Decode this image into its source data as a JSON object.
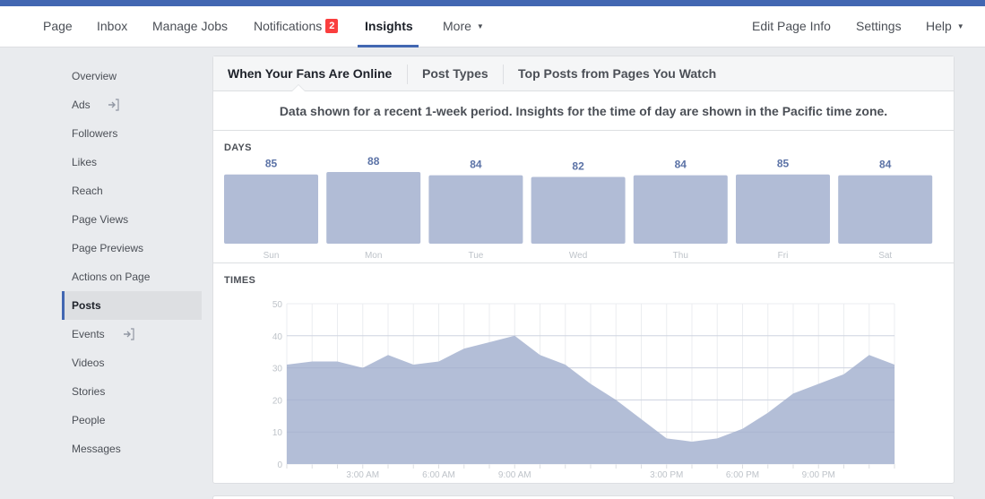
{
  "nav": {
    "left": [
      {
        "label": "Page"
      },
      {
        "label": "Inbox"
      },
      {
        "label": "Manage Jobs"
      },
      {
        "label": "Notifications",
        "badge": "2"
      },
      {
        "label": "Insights",
        "active": true
      },
      {
        "label": "More",
        "dropdown": true
      }
    ],
    "right": [
      {
        "label": "Edit Page Info"
      },
      {
        "label": "Settings"
      },
      {
        "label": "Help",
        "dropdown": true
      }
    ],
    "accent_color": "#4267b2",
    "badge_color": "#fa3e3e"
  },
  "sidebar": {
    "items": [
      {
        "label": "Overview"
      },
      {
        "label": "Ads",
        "icon": "external-link-icon"
      },
      {
        "label": "Followers"
      },
      {
        "label": "Likes"
      },
      {
        "label": "Reach"
      },
      {
        "label": "Page Views"
      },
      {
        "label": "Page Previews"
      },
      {
        "label": "Actions on Page"
      },
      {
        "label": "Posts",
        "active": true
      },
      {
        "label": "Events",
        "icon": "external-link-icon"
      },
      {
        "label": "Videos"
      },
      {
        "label": "Stories"
      },
      {
        "label": "People"
      },
      {
        "label": "Messages"
      }
    ]
  },
  "main": {
    "tabs": [
      {
        "label": "When Your Fans Are Online",
        "active": true
      },
      {
        "label": "Post Types"
      },
      {
        "label": "Top Posts from Pages You Watch"
      }
    ],
    "info_text": "Data shown for a recent 1-week period. Insights for the time of day are shown in the Pacific time zone.",
    "days_title": "DAYS",
    "times_title": "TIMES"
  },
  "chart_data": [
    {
      "type": "bar",
      "title": "DAYS",
      "categories": [
        "Sun",
        "Mon",
        "Tue",
        "Wed",
        "Thu",
        "Fri",
        "Sat"
      ],
      "values": [
        85,
        88,
        84,
        82,
        84,
        85,
        84
      ],
      "data_labels": true,
      "color": "#b1bcd6",
      "label_color": "#5b72a6"
    },
    {
      "type": "area",
      "title": "TIMES",
      "x": [
        0,
        1,
        2,
        3,
        4,
        5,
        6,
        7,
        8,
        9,
        10,
        11,
        12,
        13,
        14,
        15,
        16,
        17,
        18,
        19,
        20,
        21,
        22,
        23,
        24
      ],
      "values": [
        31,
        32,
        32,
        30,
        34,
        31,
        32,
        36,
        38,
        40,
        34,
        31,
        25,
        20,
        14,
        8,
        7,
        8,
        11,
        16,
        22,
        25,
        28,
        34,
        31
      ],
      "xlabel": "",
      "ylabel": "",
      "ylim": [
        0,
        50
      ],
      "yticks": [
        0,
        10,
        20,
        30,
        40,
        50
      ],
      "xtick_labels": [
        {
          "x": 3,
          "label": "3:00 AM"
        },
        {
          "x": 6,
          "label": "6:00 AM"
        },
        {
          "x": 9,
          "label": "9:00 AM"
        },
        {
          "x": 15,
          "label": "3:00 PM"
        },
        {
          "x": 18,
          "label": "6:00 PM"
        },
        {
          "x": 21,
          "label": "9:00 PM"
        }
      ],
      "grid": true,
      "color": "#b1bcd6"
    }
  ]
}
